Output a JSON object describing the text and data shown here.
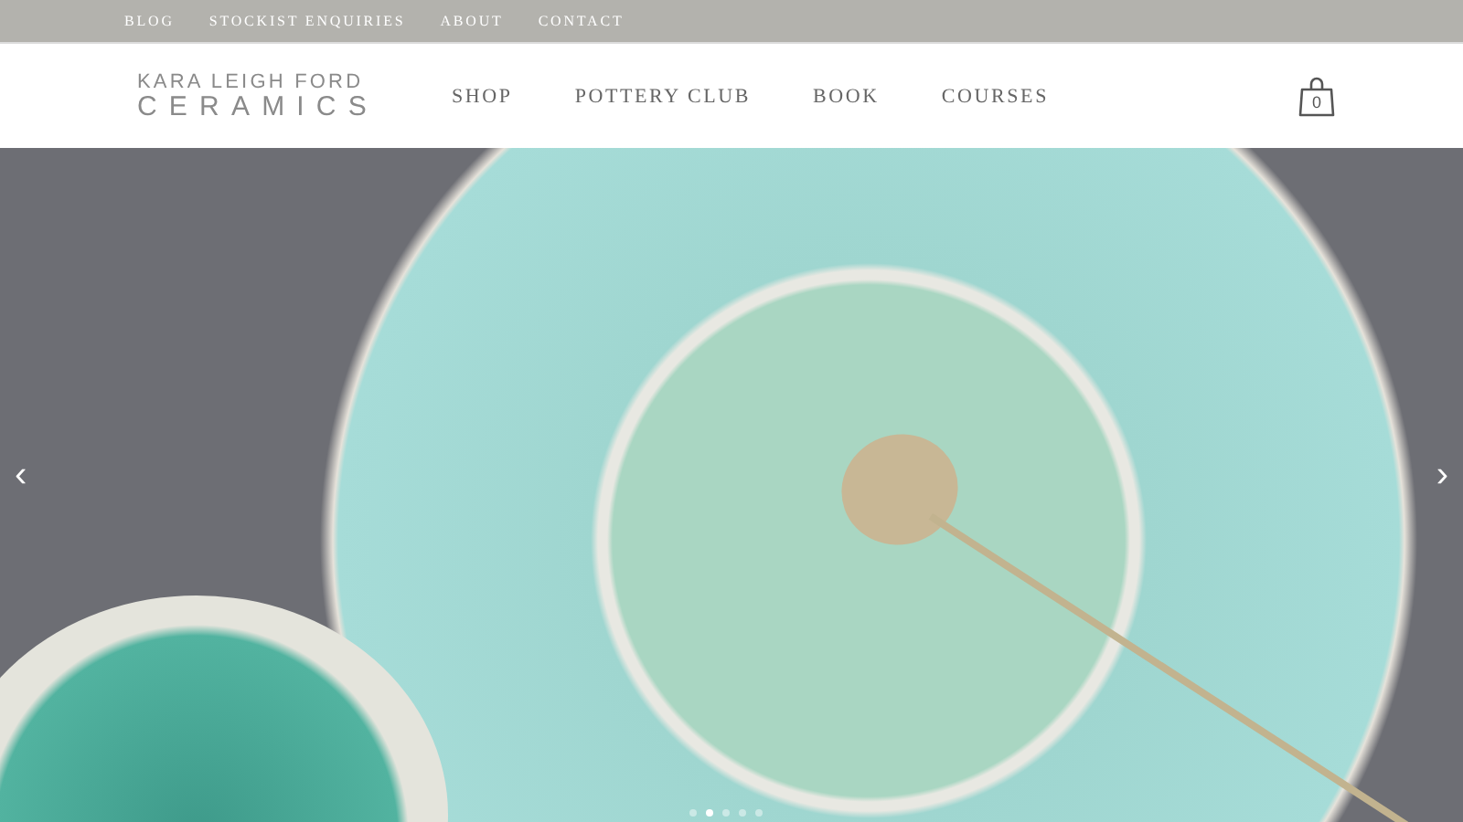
{
  "top_links": [
    "BLOG",
    "STOCKIST ENQUIRIES",
    "ABOUT",
    "CONTACT"
  ],
  "logo": {
    "line_1": "KARA LEIGH FORD",
    "line_2": "CERAMICS"
  },
  "nav": [
    "SHOP",
    "POTTERY CLUB",
    "BOOK",
    "COURSES"
  ],
  "cart": {
    "count": "0"
  },
  "slider": {
    "prev": "‹",
    "next": "›",
    "dots": [
      {
        "selected": false
      },
      {
        "selected": true
      },
      {
        "selected": false
      },
      {
        "selected": false
      },
      {
        "selected": false
      }
    ]
  }
}
